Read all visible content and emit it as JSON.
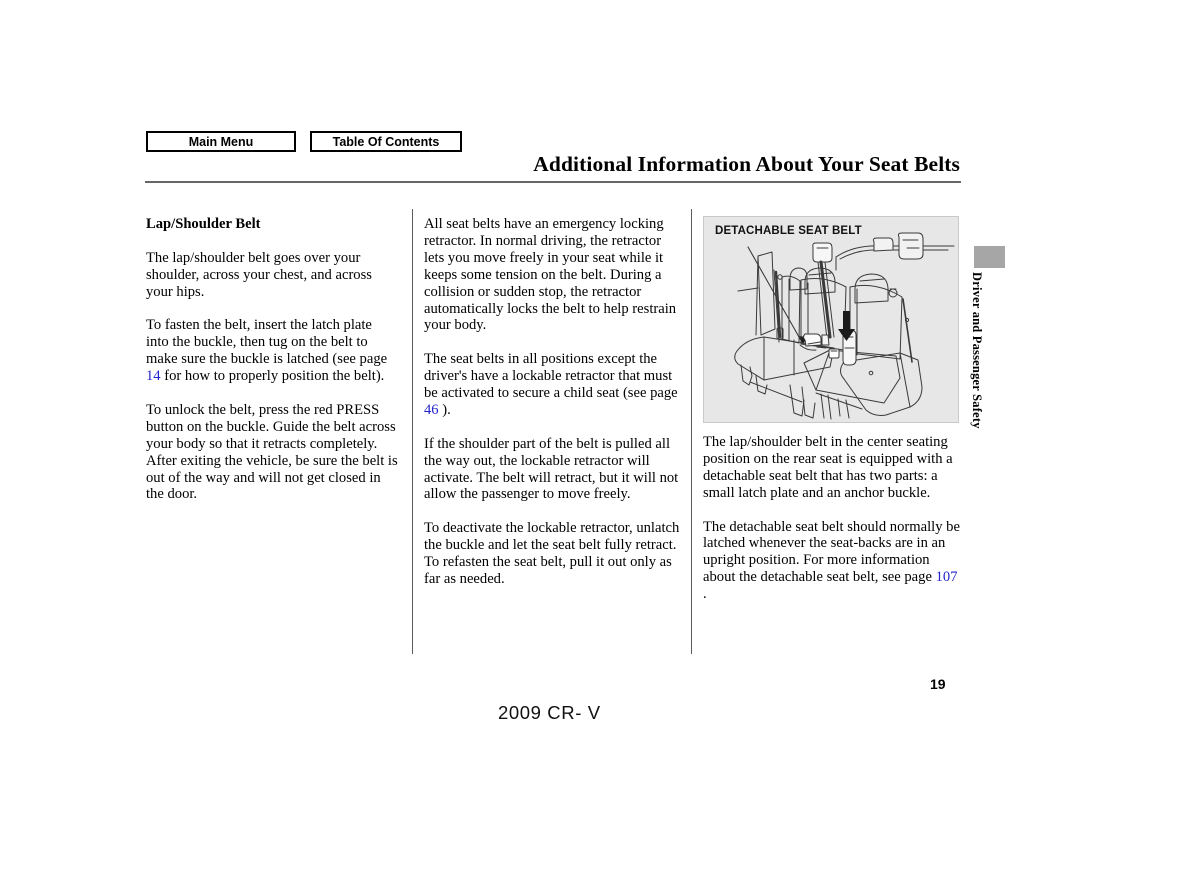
{
  "nav": {
    "main_menu_label": "Main Menu",
    "table_of_contents_label": "Table Of Contents"
  },
  "header": {
    "title": "Additional Information About Your Seat Belts"
  },
  "side_tab": {
    "label": "Driver and Passenger Safety"
  },
  "columns": {
    "col1": {
      "heading": "Lap/Shoulder Belt",
      "p1": "The lap/shoulder belt goes over your shoulder, across your chest, and across your hips.",
      "p2_before": "To fasten the belt, insert the latch plate into the buckle, then tug on the belt to make sure the buckle is latched (see page ",
      "p2_ref": "14",
      "p2_after": " for how to properly position the belt).",
      "p3": "To unlock the belt, press the red PRESS button on the buckle. Guide the belt across your body so that it retracts completely. After exiting the vehicle, be sure the belt is out of the way and will not get closed in the door."
    },
    "col2": {
      "p1": "All seat belts have an emergency locking retractor. In normal driving, the retractor lets you move freely in your seat while it keeps some tension on the belt. During a collision or sudden stop, the retractor automatically locks the belt to help restrain your body.",
      "p2_before": "The seat belts in all positions except the driver's have a lockable retractor that must be activated to secure a child seat (see page ",
      "p2_ref": "46",
      "p2_after": " ).",
      "p3": "If the shoulder part of the belt is pulled all the way out, the lockable retractor will activate. The belt will retract, but it will not allow the passenger to move freely.",
      "p4": "To deactivate the lockable retractor, unlatch the buckle and let the seat belt fully retract. To refasten the seat belt, pull it out only as far as needed."
    },
    "col3": {
      "figure_caption": "DETACHABLE SEAT BELT",
      "p1": "The lap/shoulder belt in the center seating position on the rear seat is equipped with a detachable seat belt that has two parts: a small latch plate and an anchor buckle.",
      "p2_before": "The detachable seat belt should normally be latched whenever the seat-backs are in an upright position. For more information about the detachable seat belt, see page ",
      "p2_ref": "107",
      "p2_after": " ."
    }
  },
  "footer": {
    "page_number": "19",
    "model": "2009  CR- V"
  },
  "colors": {
    "page_reference_link": "#2222cc",
    "figure_background": "#e7e7e7",
    "side_tab_block": "#a6a6a6",
    "rule": "#666666"
  }
}
